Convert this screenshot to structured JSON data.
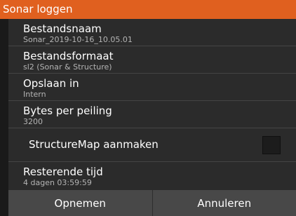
{
  "dialog": {
    "title": "Sonar loggen"
  },
  "rows": [
    {
      "label": "Bestandsnaam",
      "value": "Sonar_2019-10-16_10.05.01"
    },
    {
      "label": "Bestandsformaat",
      "value": "sl2 (Sonar & Structure)"
    },
    {
      "label": "Opslaan in",
      "value": "Intern"
    },
    {
      "label": "Bytes per peiling",
      "value": "3200"
    },
    {
      "label": "StructureMap aanmaken",
      "checked": false
    },
    {
      "label": "Resterende tijd",
      "value": "4 dagen 03:59:59"
    }
  ],
  "footer": {
    "record_label": "Opnemen",
    "cancel_label": "Annuleren"
  },
  "colors": {
    "title_bar": "#e0601f",
    "list_background": "#2b2b2b",
    "footer_background": "#484848"
  }
}
